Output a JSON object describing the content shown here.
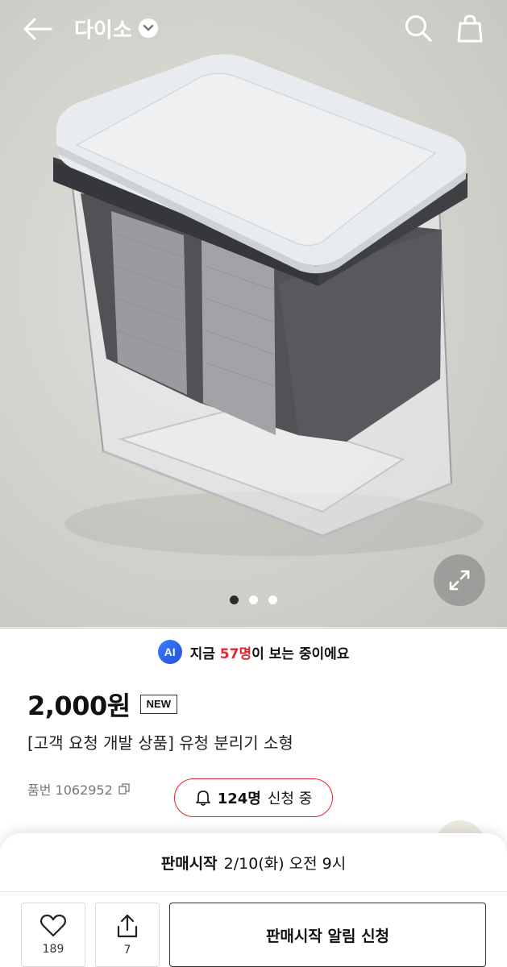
{
  "header": {
    "brand": "다이소",
    "icons": [
      "back-arrow-icon",
      "chevron-down-icon",
      "search-icon",
      "shopping-bag-icon"
    ]
  },
  "gallery": {
    "image_count": 3,
    "active_index": 0,
    "expand_icon": "expand-icon"
  },
  "viewing": {
    "badge": "AI",
    "prefix": "지금 ",
    "count": "57명",
    "suffix": "이 보는 중이에요"
  },
  "product": {
    "price": "2,000원",
    "badge": "NEW",
    "title": "[고객 요청 개발 상품] 유청 분리기 소형",
    "sku_label": "품번 1062952",
    "apply_count": "124명",
    "apply_text": "신청 중"
  },
  "sheet": {
    "sale_label": "판매시작",
    "sale_datetime": "2/10(화) 오전 9시",
    "like_count": "189",
    "share_count": "7",
    "notify_button": "판매시작 알림 신청"
  },
  "colors": {
    "accent_red": "#e0262f",
    "ai_blue": "#2f63f0",
    "text": "#111111"
  }
}
